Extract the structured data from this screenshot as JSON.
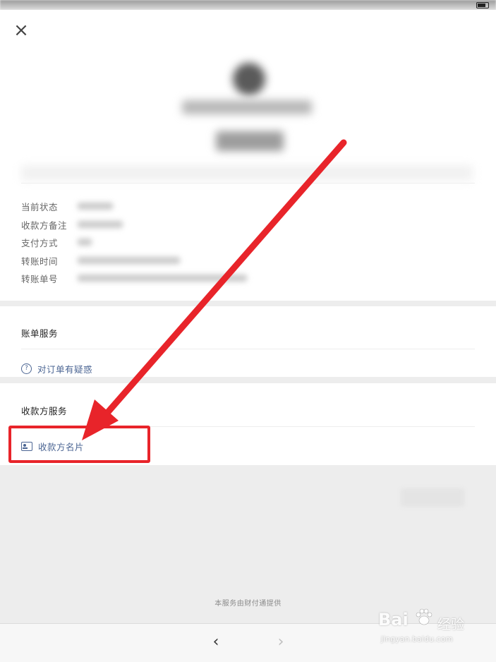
{
  "header": {
    "close_icon": "close-icon"
  },
  "details": {
    "rows": [
      {
        "label": "当前状态"
      },
      {
        "label": "收款方备注"
      },
      {
        "label": "支付方式"
      },
      {
        "label": "转账时间"
      },
      {
        "label": "转账单号"
      }
    ]
  },
  "bill_service": {
    "title": "账单服务",
    "item_label": "对订单有疑惑",
    "item_icon": "question-circle-icon"
  },
  "payee_service": {
    "title": "收款方服务",
    "item_label": "收款方名片",
    "item_icon": "contact-card-icon"
  },
  "footer": {
    "note": "本服务由财付通提供"
  },
  "nav": {
    "back_icon": "chevron-left-icon",
    "forward_icon": "chevron-right-icon"
  },
  "watermark": {
    "brand": "Bai",
    "brand_cn": "经验",
    "url": "jingyan.baidu.com"
  },
  "colors": {
    "link": "#4b6593",
    "annotation": "#e8242a",
    "background": "#ededed"
  }
}
